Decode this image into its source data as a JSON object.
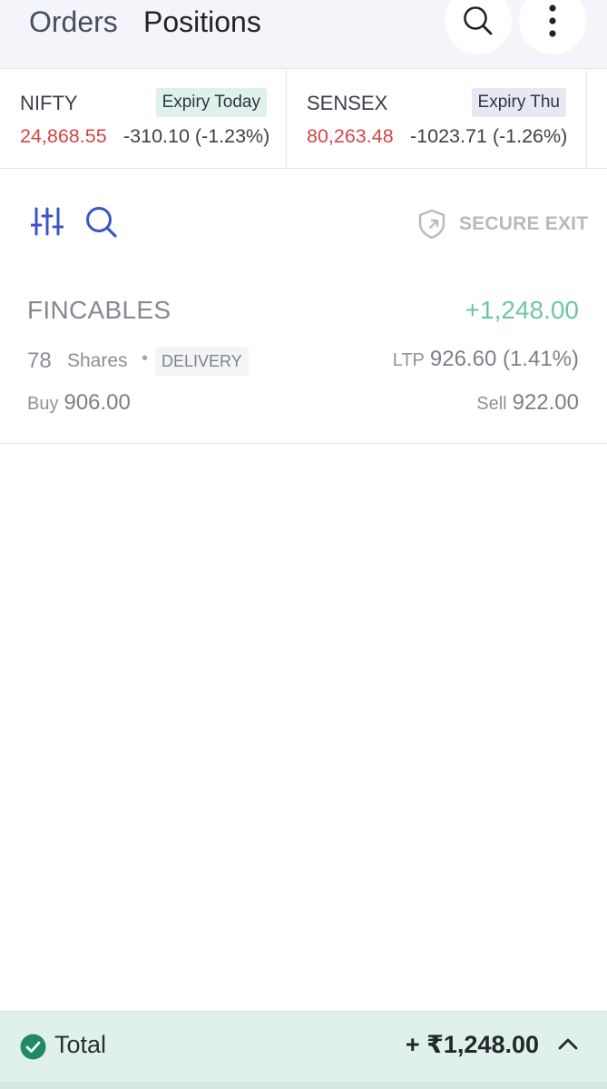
{
  "header": {
    "tabs": [
      {
        "label": "Orders"
      },
      {
        "label": "Positions"
      }
    ],
    "icons": {
      "search": "search-icon",
      "menu": "more-vertical-icon"
    }
  },
  "indices": [
    {
      "name": "NIFTY",
      "expiry": "Expiry Today",
      "value": "24,868.55",
      "change": "-310.10 (-1.23%)"
    },
    {
      "name": "SENSEX",
      "expiry": "Expiry Thu",
      "value": "80,263.48",
      "change": "-1023.71 (-1.26%)"
    }
  ],
  "toolbar": {
    "secure_exit_label": "SECURE EXIT"
  },
  "position": {
    "symbol": "FINCABLES",
    "pnl": "+1,248.00",
    "qty": "78",
    "qty_unit": "Shares",
    "separator": "•",
    "product": "DELIVERY",
    "ltp_label": "LTP",
    "ltp": "926.60 (1.41%)",
    "buy_label": "Buy",
    "buy_price": "906.00",
    "sell_label": "Sell",
    "sell_price": "922.00"
  },
  "footer": {
    "label": "Total",
    "total": "+ ₹1,248.00"
  },
  "colors": {
    "accent": "#3b55c6",
    "loss": "#d14646",
    "profit": "#6ec7a3",
    "footer_bg": "#e0f1ec",
    "check": "#1f8a63"
  }
}
